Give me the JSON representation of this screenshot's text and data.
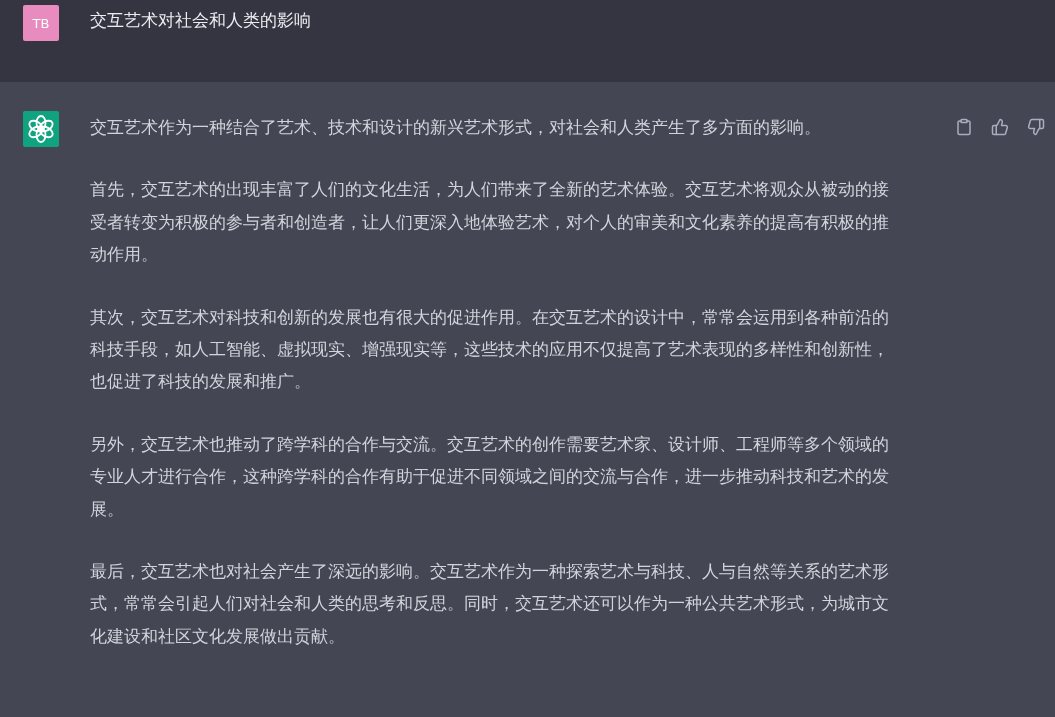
{
  "user_message": {
    "avatar": "TB",
    "text": "交互艺术对社会和人类的影响"
  },
  "assistant_message": {
    "paragraphs": [
      "交互艺术作为一种结合了艺术、技术和设计的新兴艺术形式，对社会和人类产生了多方面的影响。",
      "首先，交互艺术的出现丰富了人们的文化生活，为人们带来了全新的艺术体验。交互艺术将观众从被动的接受者转变为积极的参与者和创造者，让人们更深入地体验艺术，对个人的审美和文化素养的提高有积极的推动作用。",
      "其次，交互艺术对科技和创新的发展也有很大的促进作用。在交互艺术的设计中，常常会运用到各种前沿的科技手段，如人工智能、虚拟现实、增强现实等，这些技术的应用不仅提高了艺术表现的多样性和创新性，也促进了科技的发展和推广。",
      "另外，交互艺术也推动了跨学科的合作与交流。交互艺术的创作需要艺术家、设计师、工程师等多个领域的专业人才进行合作，这种跨学科的合作有助于促进不同领域之间的交流与合作，进一步推动科技和艺术的发展。",
      "最后，交互艺术也对社会产生了深远的影响。交互艺术作为一种探索艺术与科技、人与自然等关系的艺术形式，常常会引起人们对社会和人类的思考和反思。同时，交互艺术还可以作为一种公共艺术形式，为城市文化建设和社区文化发展做出贡献。"
    ]
  }
}
